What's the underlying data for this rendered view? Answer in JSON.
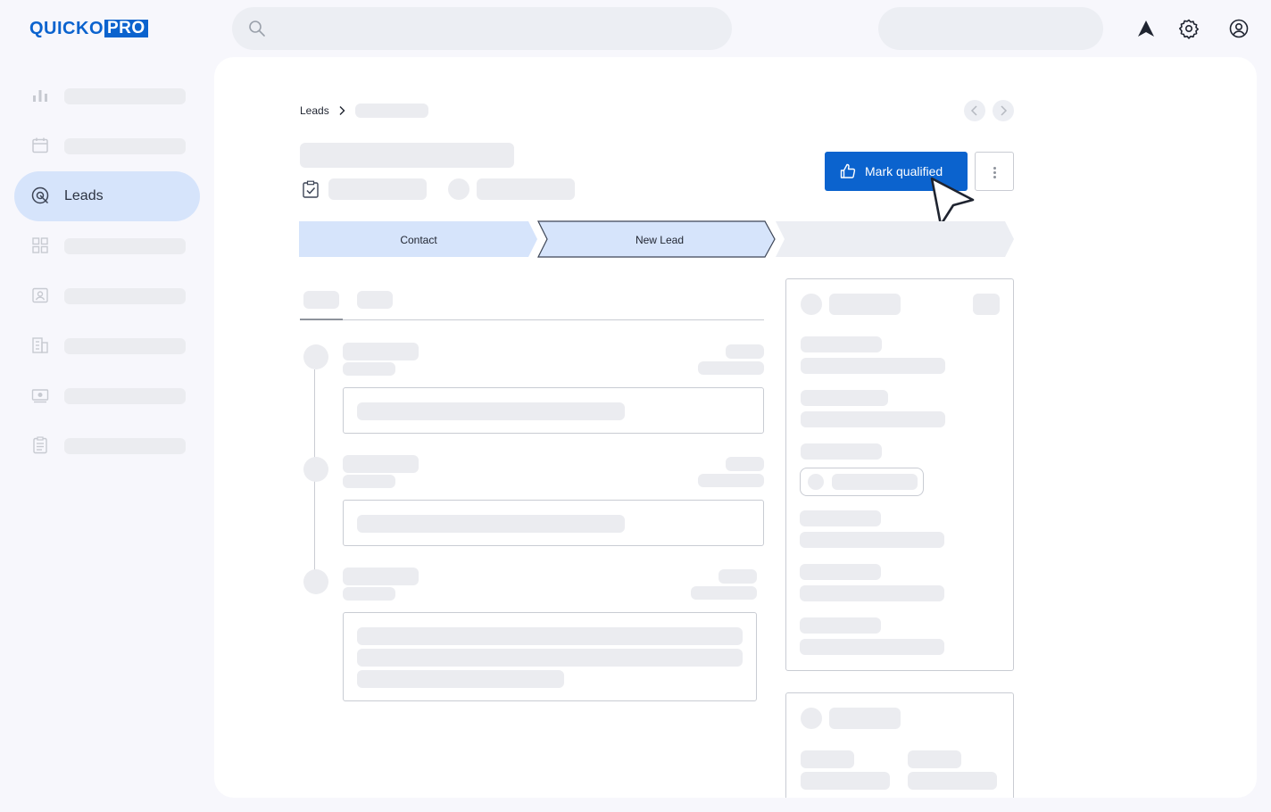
{
  "app": {
    "logo_prefix": "QUICKO",
    "logo_suffix": "PRO"
  },
  "sidebar": {
    "active_label": "Leads",
    "icons": [
      "chart-icon",
      "calendar-icon",
      "leads-icon",
      "grid-icon",
      "contact-card-icon",
      "building-icon",
      "money-icon",
      "clipboard-icon"
    ]
  },
  "breadcrumb": {
    "root": "Leads"
  },
  "actions": {
    "primary_label": "Mark qualified"
  },
  "stages": [
    "Contact",
    "New Lead",
    ""
  ],
  "colors": {
    "accent": "#0b63ce",
    "active_bg": "#d6e4fb",
    "skeleton": "#ebecf0"
  }
}
